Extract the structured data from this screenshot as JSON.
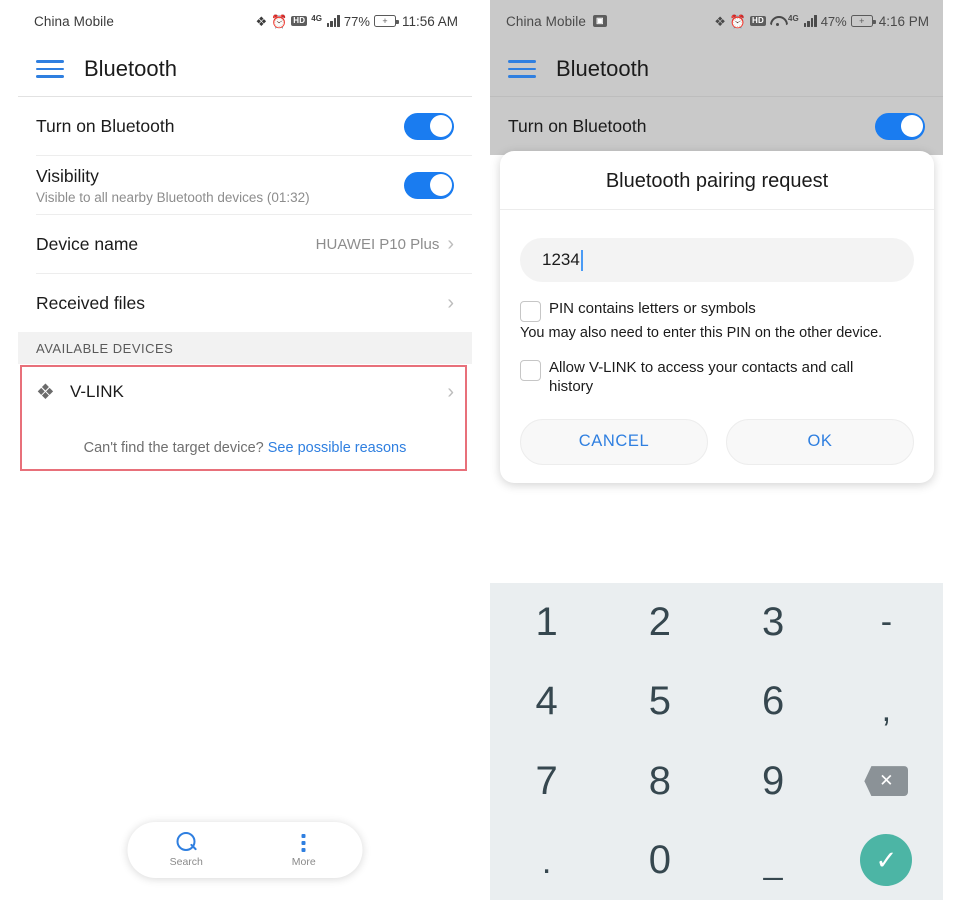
{
  "left_phone": {
    "status_bar": {
      "carrier": "China Mobile",
      "bluetooth_icon": "bluetooth-icon",
      "alarm_icon": "alarm-icon",
      "hd_badge": "HD",
      "network_type": "4G",
      "battery_percent": "77%",
      "clock": "11:56 AM"
    },
    "app_bar": {
      "menu_icon": "hamburger-menu-icon",
      "title": "Bluetooth"
    },
    "rows": [
      {
        "title": "Turn on Bluetooth",
        "sub": "",
        "value": "",
        "control": "toggle",
        "toggle_on": true
      },
      {
        "title": "Visibility",
        "sub": "Visible to all nearby Bluetooth devices (01:32)",
        "value": "",
        "control": "toggle",
        "toggle_on": true
      },
      {
        "title": "Device name",
        "sub": "",
        "value": "HUAWEI P10 Plus",
        "control": "chevron",
        "toggle_on": false
      },
      {
        "title": "Received files",
        "sub": "",
        "value": "",
        "control": "chevron",
        "toggle_on": false
      }
    ],
    "available_devices": {
      "section_header": "AVAILABLE DEVICES",
      "highlight_color": "#e8707a",
      "devices": [
        {
          "name": "V-LINK",
          "icon": "bluetooth-icon"
        }
      ]
    },
    "help": {
      "question": "Can't find the target device?",
      "link": "See possible reasons",
      "link_color": "#2f7fe0"
    },
    "bottom_nav": [
      {
        "label": "Search",
        "icon": "search-icon"
      },
      {
        "label": "More",
        "icon": "more-vertical-icon"
      }
    ]
  },
  "right_phone": {
    "status_bar": {
      "carrier": "China Mobile",
      "sim_badge": "SIM",
      "bluetooth_icon": "bluetooth-icon",
      "alarm_icon": "alarm-icon",
      "hd_badge": "HD",
      "wifi_icon": "wifi-icon",
      "network_type": "4G",
      "battery_percent": "47%",
      "clock": "4:16 PM"
    },
    "app_bar": {
      "menu_icon": "hamburger-menu-icon",
      "title": "Bluetooth"
    },
    "background_row_title": "Turn on Bluetooth",
    "dialog": {
      "title": "Bluetooth pairing request",
      "pin_value": "1234",
      "checkbox_1": {
        "label": "PIN contains letters or symbols",
        "checked": false
      },
      "hint": "You may also need to enter this PIN on the other device.",
      "checkbox_2": {
        "label": "Allow V-LINK to access your contacts and call history",
        "checked": false
      },
      "cancel_label": "CANCEL",
      "ok_label": "OK",
      "button_text_color": "#2f7fe0"
    },
    "keypad": {
      "background": "#eaeef0",
      "keys": [
        "1",
        "2",
        "3",
        "-",
        "4",
        "5",
        "6",
        ",",
        "7",
        "8",
        "9",
        "backspace",
        ".",
        "0",
        "_",
        "enter"
      ],
      "backspace_icon": "backspace-icon",
      "enter_icon": "check-icon",
      "enter_color": "#4cb5a5",
      "backspace_color": "#8b9297"
    }
  }
}
